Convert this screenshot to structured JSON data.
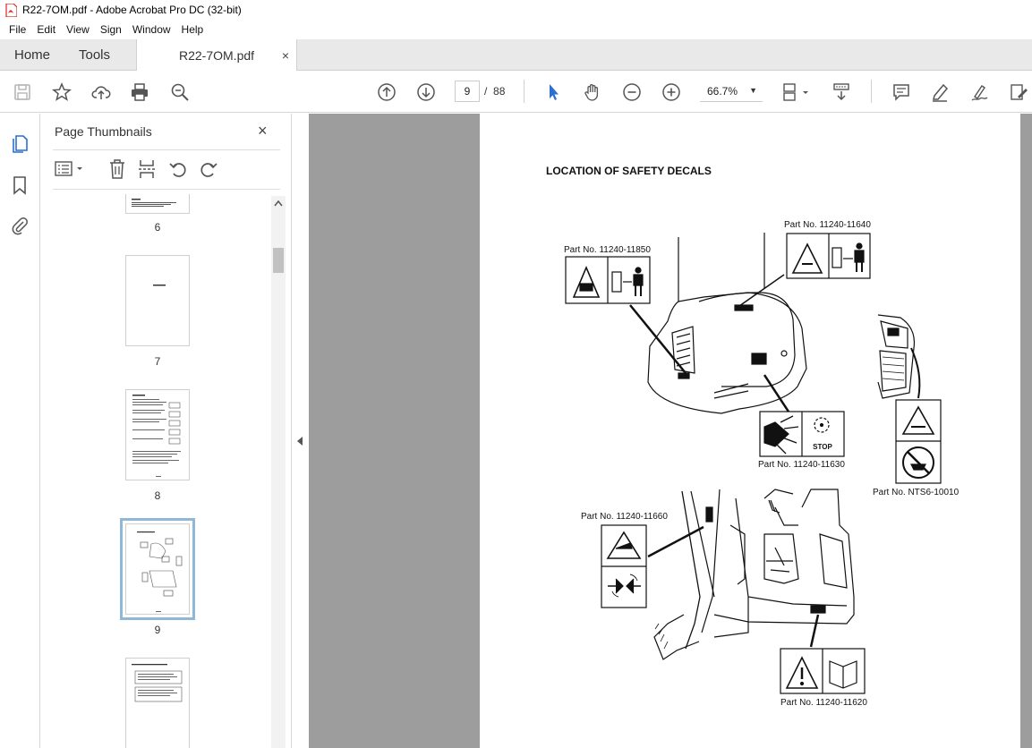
{
  "window": {
    "title": "R22-7OM.pdf - Adobe Acrobat Pro DC (32-bit)"
  },
  "menu": [
    "File",
    "Edit",
    "View",
    "Sign",
    "Window",
    "Help"
  ],
  "tabs": {
    "home": "Home",
    "tools": "Tools",
    "document": "R22-7OM.pdf",
    "close": "×"
  },
  "nav": {
    "current_page": "9",
    "separator": "/",
    "total_pages": "88",
    "zoom": "66.7%"
  },
  "panel": {
    "title": "Page Thumbnails",
    "close": "×"
  },
  "thumbnails": [
    {
      "label": "6"
    },
    {
      "label": "7"
    },
    {
      "label": "8"
    },
    {
      "label": "9"
    },
    {
      "label": ""
    }
  ],
  "document": {
    "heading": "LOCATION OF SAFETY DECALS",
    "parts": {
      "p1": "Part No. 11240-11850",
      "p2": "Part No. 11240-11640",
      "p3": "Part No. 11240-11630",
      "p4": "Part No. NTS6-10010",
      "p5": "Part No. 11240-11660",
      "p6": "Part No. 11240-11620"
    },
    "stop_text": "STOP"
  },
  "colors": {
    "tab_bg": "#e9e9e9",
    "doc_bg": "#9d9d9d",
    "select_blue": "#2c6fd1",
    "pdf_red": "#d9281e"
  }
}
